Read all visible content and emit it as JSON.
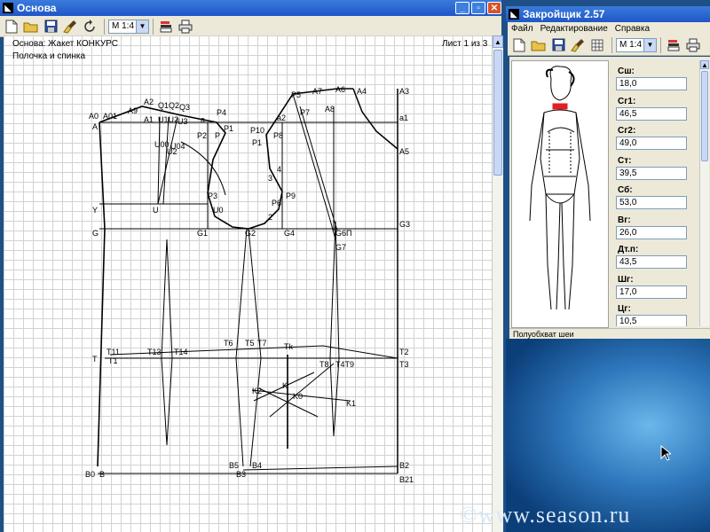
{
  "main_window": {
    "title": "Основа",
    "zoom_value": "М 1:4",
    "header_left_1": "Основа: Жакет КОНКУРС",
    "header_left_2": "Полочка и спинка",
    "header_right": "Лист 1 из 3",
    "pattern_labels": [
      "A0",
      "A01",
      "A9",
      "A2",
      "Q1",
      "Q2",
      "Q3",
      "P4",
      "A",
      "A1",
      "U1",
      "U2",
      "U3",
      "a",
      "P2",
      "P",
      "P1",
      "U00",
      "U04",
      "U02",
      "P3",
      "U0",
      "U",
      "Y",
      "G",
      "G1",
      "G2",
      "G4",
      "G3",
      "G7",
      "G6",
      "P5",
      "A7",
      "A6",
      "A4",
      "A3",
      "a1",
      "a2",
      "P7",
      "A8",
      "P10",
      "P8",
      "P9",
      "P6",
      "3",
      "4",
      "2",
      "A5",
      "T11",
      "T13",
      "T14",
      "T6",
      "T5",
      "T7",
      "Tk",
      "T2",
      "T3",
      "T",
      "T1",
      "T8",
      "T4",
      "T9",
      "K2",
      "K",
      "K0",
      "K1",
      "B0",
      "B",
      "B5",
      "B4",
      "B3",
      "B2",
      "B21"
    ]
  },
  "side_window": {
    "title": "Закройщик 2.57",
    "menu": [
      "Файл",
      "Редактирование",
      "Справка"
    ],
    "zoom_value": "М 1:4",
    "measurements": [
      {
        "label": "Сш:",
        "value": "18,0"
      },
      {
        "label": "Сг1:",
        "value": "46,5"
      },
      {
        "label": "Сг2:",
        "value": "49,0"
      },
      {
        "label": "Ст:",
        "value": "39,5"
      },
      {
        "label": "Сб:",
        "value": "53,0"
      },
      {
        "label": "Вг:",
        "value": "26,0"
      },
      {
        "label": "Дт.п:",
        "value": "43,5"
      },
      {
        "label": "Шг:",
        "value": "17,0"
      },
      {
        "label": "Цг:",
        "value": "10,5"
      }
    ],
    "status_text": "Полуобхват шеи"
  },
  "watermark": "©www.season.ru",
  "colors": {
    "title_bar": "#2a64d4",
    "close_button": "#d9532c",
    "desktop": "#2f78bd",
    "neck_highlight": "#e02020"
  }
}
